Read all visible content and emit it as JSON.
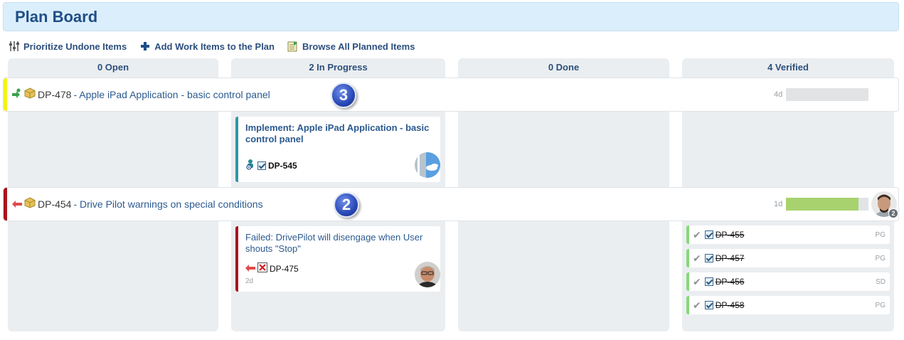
{
  "header": {
    "title": "Plan Board"
  },
  "toolbar": {
    "prioritize": "Prioritize Undone Items",
    "add_work": "Add Work Items to the Plan",
    "browse": "Browse All Planned Items"
  },
  "columns": [
    {
      "title": "0 Open"
    },
    {
      "title": "2 In Progress"
    },
    {
      "title": "0 Done"
    },
    {
      "title": "4 Verified"
    }
  ],
  "rows": [
    {
      "id": "DP-478",
      "title": "- Apple iPad Application - basic control panel",
      "badge": "3",
      "time": "4d",
      "progress": 0,
      "stripe_color": "#f2f21a",
      "cards": [
        {
          "title": "Implement: Apple iPad Application - basic control panel",
          "id": "DP-545"
        }
      ]
    },
    {
      "id": "DP-454",
      "title": "- Drive Pilot warnings on special conditions",
      "badge": "2",
      "time": "1d",
      "progress": 0.88,
      "avatar_count": "2",
      "stripe_color": "#a8141c",
      "cards": [
        {
          "title": "Failed: DrivePilot will disengage when User shouts \"Stop\"",
          "id": "DP-475",
          "age": "2d"
        }
      ],
      "verified": [
        {
          "id": "DP-455",
          "owner": "PG"
        },
        {
          "id": "DP-457",
          "owner": "PG"
        },
        {
          "id": "DP-456",
          "owner": "SD"
        },
        {
          "id": "DP-458",
          "owner": "PG"
        }
      ]
    }
  ]
}
